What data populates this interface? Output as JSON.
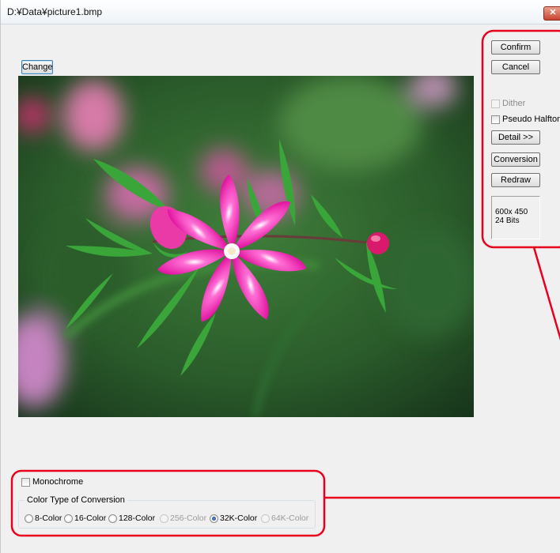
{
  "window": {
    "title": "D:¥Data¥picture1.bmp",
    "close_label": "✕"
  },
  "buttons": {
    "change": "Change",
    "confirm": "Confirm",
    "cancel": "Cancel",
    "detail": "Detail >>",
    "conversion": "Conversion",
    "redraw": "Redraw"
  },
  "options": {
    "dither": "Dither",
    "pseudo_halftone": "Pseudo Halftone"
  },
  "image_info": {
    "size": "600x 450",
    "bits": "24 Bits"
  },
  "monochrome": "Monochrome",
  "color_type": {
    "title": "Color Type of Conversion",
    "options": [
      {
        "label": "8-Color",
        "checked": false,
        "enabled": true
      },
      {
        "label": "16-Color",
        "checked": false,
        "enabled": true
      },
      {
        "label": "128-Color",
        "checked": false,
        "enabled": true
      },
      {
        "label": "256-Color",
        "checked": false,
        "enabled": false
      },
      {
        "label": "32K-Color",
        "checked": true,
        "enabled": true
      },
      {
        "label": "64K-Color",
        "checked": false,
        "enabled": false
      }
    ]
  },
  "colors": {
    "highlight": "#e8001c",
    "window_bg": "#f0f0f0"
  }
}
